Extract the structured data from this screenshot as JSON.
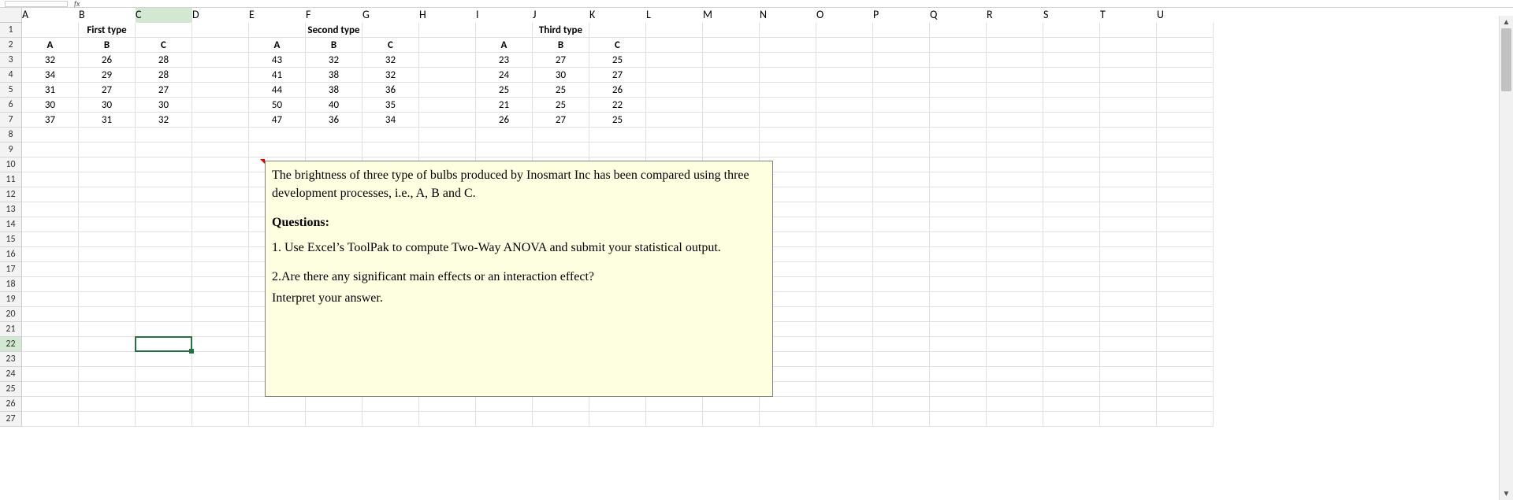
{
  "name_box_value": "C22",
  "fx_label": "fx",
  "columns": [
    "A",
    "B",
    "C",
    "D",
    "E",
    "F",
    "G",
    "H",
    "I",
    "J",
    "K",
    "L",
    "M",
    "N",
    "O",
    "P",
    "Q",
    "R",
    "S",
    "T",
    "U"
  ],
  "num_rows": 27,
  "selected_row": 22,
  "selected_col": 3,
  "cells": {
    "1": {
      "2": {
        "v": "First type",
        "b": true
      },
      "6": {
        "v": "Second type",
        "b": true
      },
      "10": {
        "v": "Third type",
        "b": true
      }
    },
    "2": {
      "1": {
        "v": "A",
        "b": true
      },
      "2": {
        "v": "B",
        "b": true
      },
      "3": {
        "v": "C",
        "b": true
      },
      "5": {
        "v": "A",
        "b": true
      },
      "6": {
        "v": "B",
        "b": true
      },
      "7": {
        "v": "C",
        "b": true
      },
      "9": {
        "v": "A",
        "b": true
      },
      "10": {
        "v": "B",
        "b": true
      },
      "11": {
        "v": "C",
        "b": true
      }
    },
    "3": {
      "1": {
        "v": "32"
      },
      "2": {
        "v": "26"
      },
      "3": {
        "v": "28"
      },
      "5": {
        "v": "43"
      },
      "6": {
        "v": "32"
      },
      "7": {
        "v": "32"
      },
      "9": {
        "v": "23"
      },
      "10": {
        "v": "27"
      },
      "11": {
        "v": "25"
      }
    },
    "4": {
      "1": {
        "v": "34"
      },
      "2": {
        "v": "29"
      },
      "3": {
        "v": "28"
      },
      "5": {
        "v": "41"
      },
      "6": {
        "v": "38"
      },
      "7": {
        "v": "32"
      },
      "9": {
        "v": "24"
      },
      "10": {
        "v": "30"
      },
      "11": {
        "v": "27"
      }
    },
    "5": {
      "1": {
        "v": "31"
      },
      "2": {
        "v": "27"
      },
      "3": {
        "v": "27"
      },
      "5": {
        "v": "44"
      },
      "6": {
        "v": "38"
      },
      "7": {
        "v": "36"
      },
      "9": {
        "v": "25"
      },
      "10": {
        "v": "25"
      },
      "11": {
        "v": "26"
      }
    },
    "6": {
      "1": {
        "v": "30"
      },
      "2": {
        "v": "30"
      },
      "3": {
        "v": "30"
      },
      "5": {
        "v": "50"
      },
      "6": {
        "v": "40"
      },
      "7": {
        "v": "35"
      },
      "9": {
        "v": "21"
      },
      "10": {
        "v": "25"
      },
      "11": {
        "v": "22"
      }
    },
    "7": {
      "1": {
        "v": "37"
      },
      "2": {
        "v": "31"
      },
      "3": {
        "v": "32"
      },
      "5": {
        "v": "47"
      },
      "6": {
        "v": "36"
      },
      "7": {
        "v": "34"
      },
      "9": {
        "v": "26"
      },
      "10": {
        "v": "27"
      },
      "11": {
        "v": "25"
      }
    }
  },
  "textbox": {
    "p1": "The brightness of three type of bulbs produced by Inosmart Inc has been compared using three development processes, i.e., A, B and C.",
    "qhdr": "Questions:",
    "q1": "1. Use Excel’s ToolPak to compute Two-Way ANOVA and submit your statistical output.",
    "q2a": "2.Are there any significant main effects or an interaction effect?",
    "q2b": "Interpret your answer."
  },
  "scroll": {
    "up": "▲",
    "down": "▼"
  }
}
